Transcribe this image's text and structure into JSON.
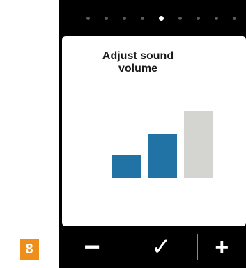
{
  "pager": {
    "total": 9,
    "active_index": 4
  },
  "screen": {
    "title": "Adjust sound\nvolume"
  },
  "volume": {
    "levels": 3,
    "current_level": 2,
    "active_color": "#2173a6",
    "inactive_color": "#d4d4d0"
  },
  "controls": {
    "decrease_label": "−",
    "confirm_label": "✓",
    "increase_label": "+"
  },
  "step_badge": {
    "label": "8",
    "color": "#ef8f1a"
  }
}
